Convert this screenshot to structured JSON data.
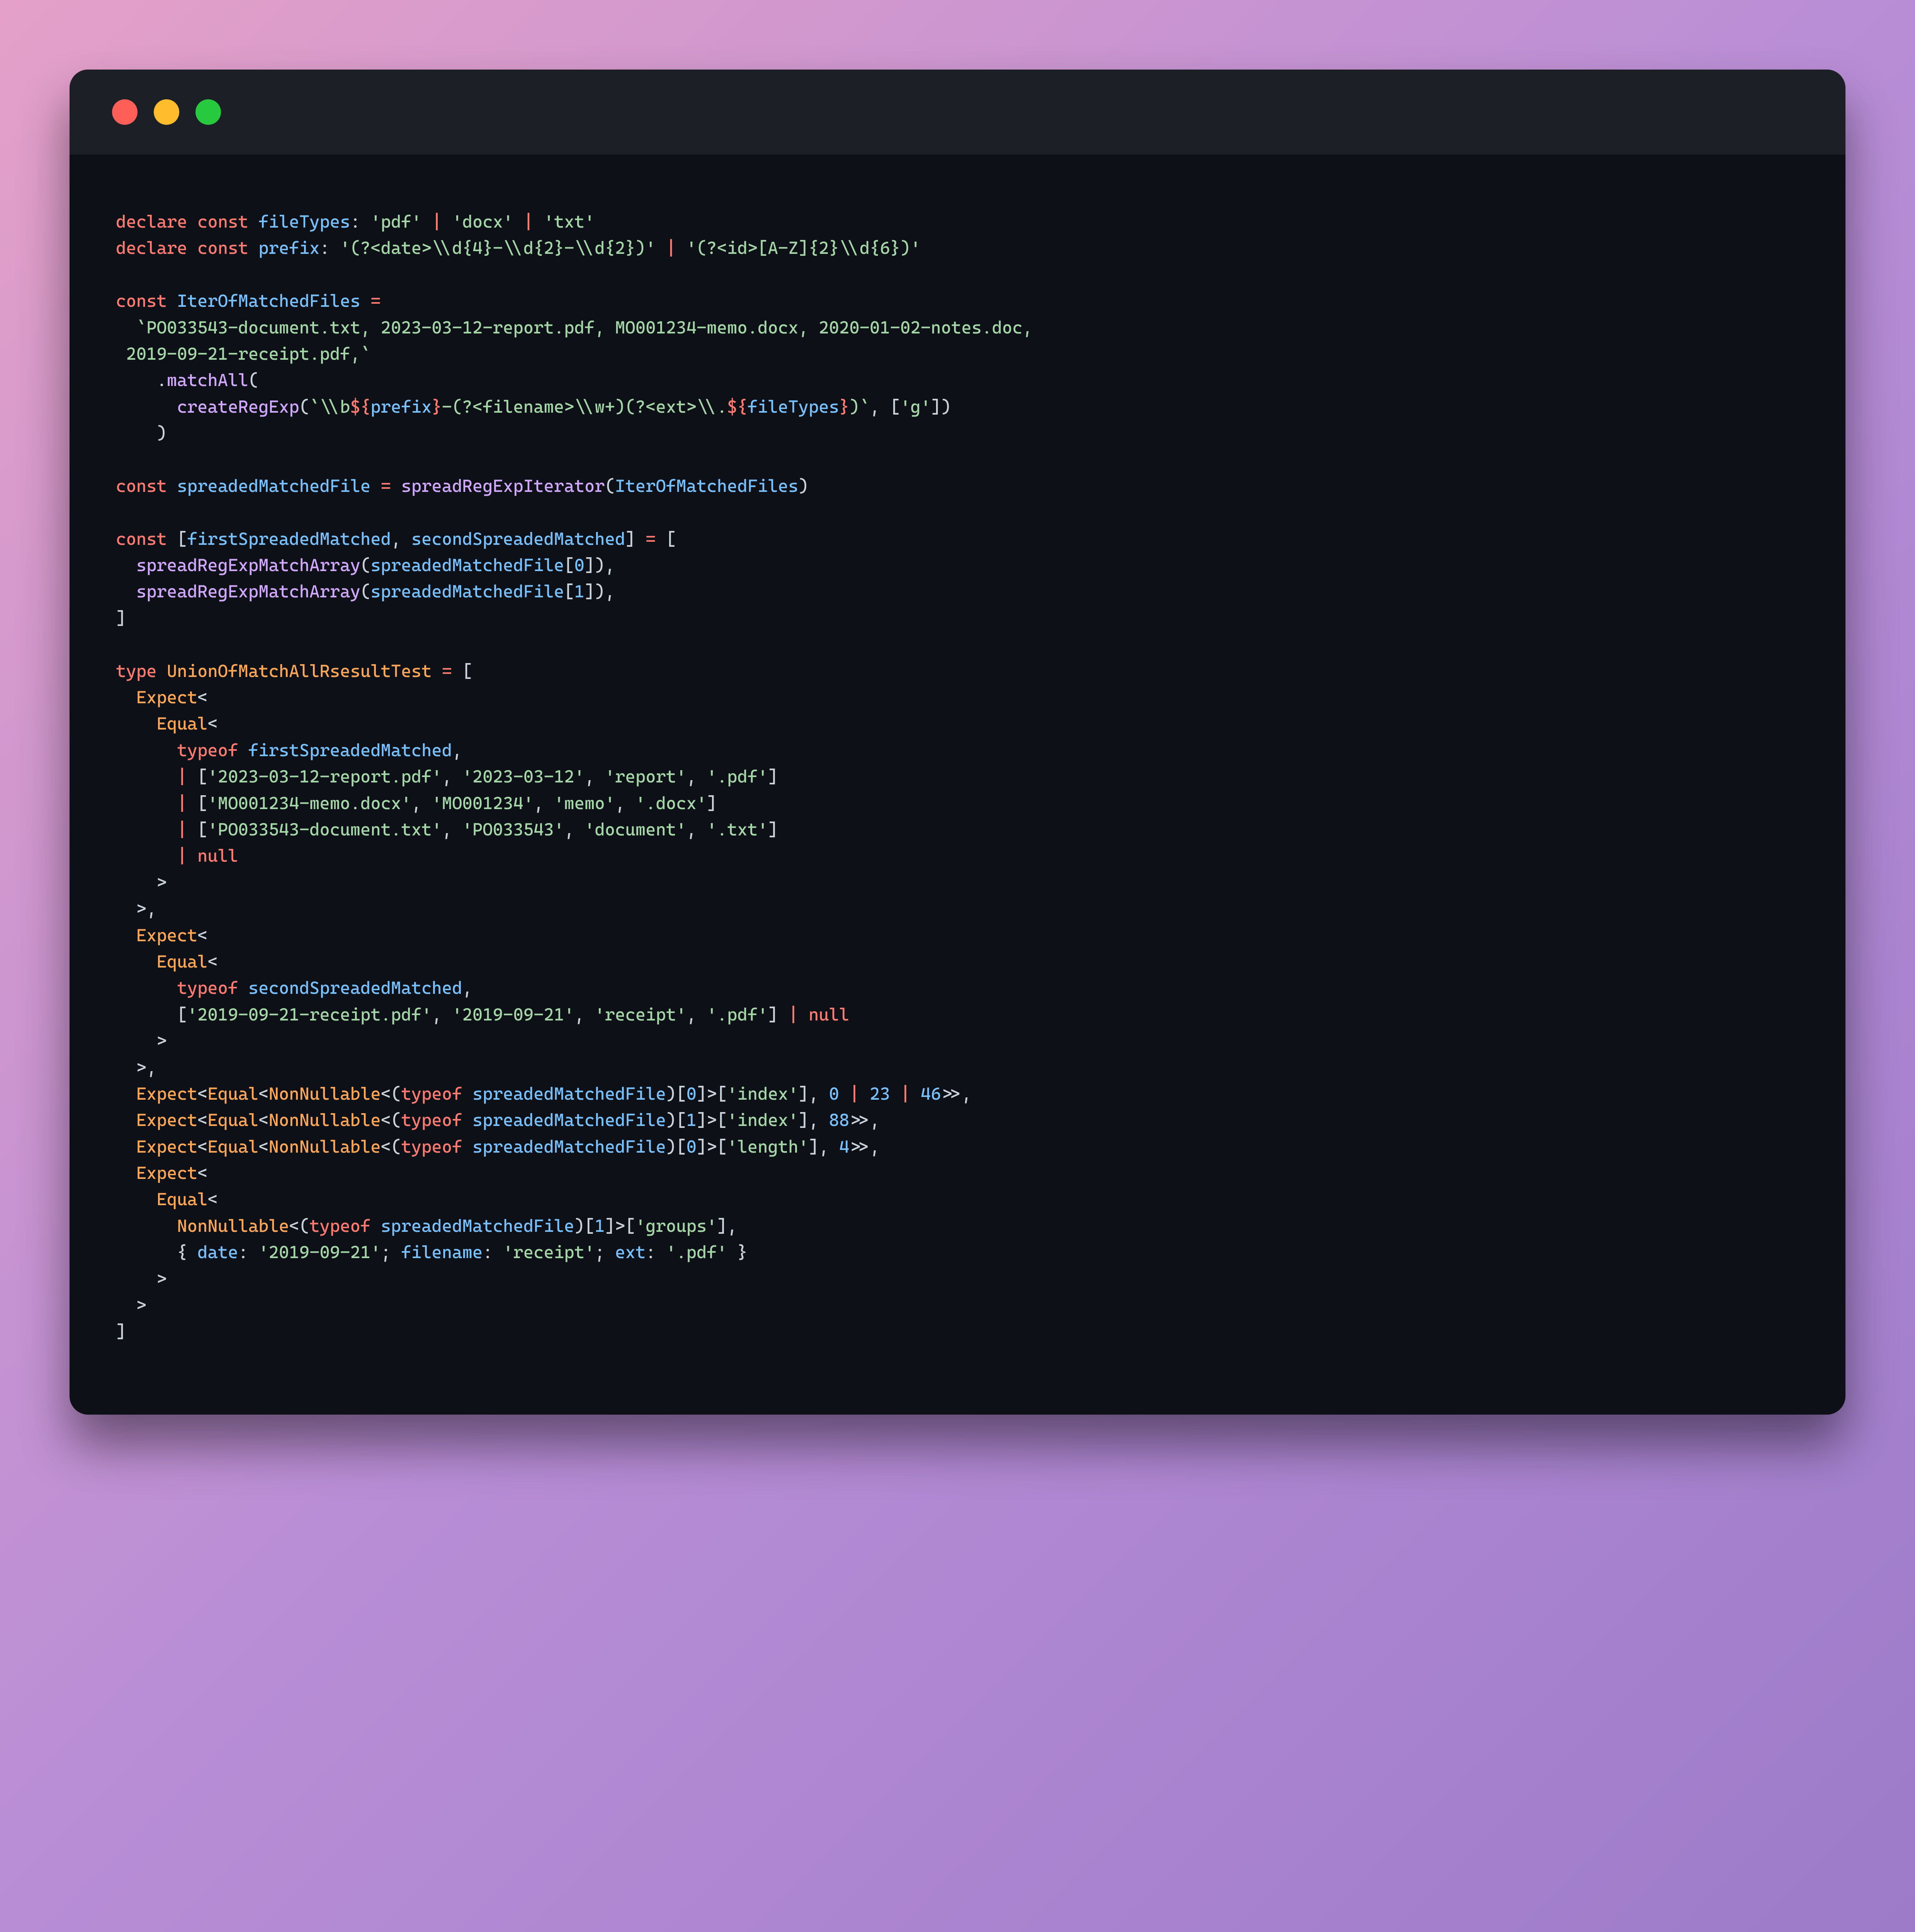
{
  "code": {
    "l01": {
      "a": "declare",
      "b": "const",
      "c": "fileTypes",
      "d": ":",
      "e": "'pdf'",
      "f": "|",
      "g": "'docx'",
      "h": "|",
      "i": "'txt'"
    },
    "l02": {
      "a": "declare",
      "b": "const",
      "c": "prefix",
      "d": ":",
      "e": "'(?<date>\\\\d{4}-\\\\d{2}-\\\\d{2})'",
      "f": "|",
      "g": "'(?<id>[A-Z]{2}\\\\d{6})'"
    },
    "l03": {
      "a": "const",
      "b": "IterOfMatchedFiles",
      "c": "="
    },
    "l04": {
      "a": "`PO033543-document.txt, 2023-03-12-report.pdf, MO001234-memo.docx, 2020-01-02-notes.doc,"
    },
    "l05": {
      "a": " 2019-09-21-receipt.pdf,`"
    },
    "l06": {
      "a": ".",
      "b": "matchAll",
      "c": "("
    },
    "l07": {
      "a": "createRegExp",
      "b": "(",
      "c": "`\\\\b",
      "d": "${",
      "e": "prefix",
      "f": "}",
      "g": "-(?<filename>\\\\w+)(?<ext>\\\\.",
      "h": "${",
      "i": "fileTypes",
      "j": "}",
      "k": ")`",
      "l": ", [",
      "m": "'g'",
      "n": "])"
    },
    "l08": {
      "a": ")"
    },
    "l09": {
      "a": "const",
      "b": "spreadedMatchedFile",
      "c": "=",
      "d": "spreadRegExpIterator",
      "e": "(",
      "f": "IterOfMatchedFiles",
      "g": ")"
    },
    "l10": {
      "a": "const",
      "b": "[",
      "c": "firstSpreadedMatched",
      "d": ",",
      "e": "secondSpreadedMatched",
      "f": "]",
      "g": "=",
      "h": "["
    },
    "l11": {
      "a": "spreadRegExpMatchArray",
      "b": "(",
      "c": "spreadedMatchedFile",
      "d": "[",
      "e": "0",
      "f": "]),"
    },
    "l12": {
      "a": "spreadRegExpMatchArray",
      "b": "(",
      "c": "spreadedMatchedFile",
      "d": "[",
      "e": "1",
      "f": "]),"
    },
    "l13": {
      "a": "]"
    },
    "l14": {
      "a": "type",
      "b": "UnionOfMatchAllRsesultTest",
      "c": "=",
      "d": "["
    },
    "l15": {
      "a": "Expect",
      "b": "<"
    },
    "l16": {
      "a": "Equal",
      "b": "<"
    },
    "l17": {
      "a": "typeof",
      "b": "firstSpreadedMatched",
      "c": ","
    },
    "l18": {
      "a": "|",
      "b": "[",
      "c": "'2023-03-12-report.pdf'",
      "d": ",",
      "e": "'2023-03-12'",
      "f": ",",
      "g": "'report'",
      "h": ",",
      "i": "'.pdf'",
      "j": "]"
    },
    "l19": {
      "a": "|",
      "b": "[",
      "c": "'MO001234-memo.docx'",
      "d": ",",
      "e": "'MO001234'",
      "f": ",",
      "g": "'memo'",
      "h": ",",
      "i": "'.docx'",
      "j": "]"
    },
    "l20": {
      "a": "|",
      "b": "[",
      "c": "'PO033543-document.txt'",
      "d": ",",
      "e": "'PO033543'",
      "f": ",",
      "g": "'document'",
      "h": ",",
      "i": "'.txt'",
      "j": "]"
    },
    "l21": {
      "a": "|",
      "b": "null"
    },
    "l22": {
      "a": ">"
    },
    "l23": {
      "a": ">,"
    },
    "l24": {
      "a": "Expect",
      "b": "<"
    },
    "l25": {
      "a": "Equal",
      "b": "<"
    },
    "l26": {
      "a": "typeof",
      "b": "secondSpreadedMatched",
      "c": ","
    },
    "l27": {
      "a": "[",
      "b": "'2019-09-21-receipt.pdf'",
      "c": ",",
      "d": "'2019-09-21'",
      "e": ",",
      "f": "'receipt'",
      "g": ",",
      "h": "'.pdf'",
      "i": "]",
      "j": "|",
      "k": "null"
    },
    "l28": {
      "a": ">"
    },
    "l29": {
      "a": ">,"
    },
    "l30": {
      "a": "Expect",
      "b": "<",
      "c": "Equal",
      "d": "<",
      "e": "NonNullable",
      "f": "<(",
      "g": "typeof",
      "h": "spreadedMatchedFile",
      "i": ")[",
      "j": "0",
      "k": "]>[",
      "l": "'index'",
      "m": "],",
      "n": "0",
      "o": "|",
      "p": "23",
      "q": "|",
      "r": "46",
      "s": ">>,"
    },
    "l31": {
      "a": "Expect",
      "b": "<",
      "c": "Equal",
      "d": "<",
      "e": "NonNullable",
      "f": "<(",
      "g": "typeof",
      "h": "spreadedMatchedFile",
      "i": ")[",
      "j": "1",
      "k": "]>[",
      "l": "'index'",
      "m": "],",
      "n": "88",
      "o": ">>,"
    },
    "l32": {
      "a": "Expect",
      "b": "<",
      "c": "Equal",
      "d": "<",
      "e": "NonNullable",
      "f": "<(",
      "g": "typeof",
      "h": "spreadedMatchedFile",
      "i": ")[",
      "j": "0",
      "k": "]>[",
      "l": "'length'",
      "m": "],",
      "n": "4",
      "o": ">>,"
    },
    "l33": {
      "a": "Expect",
      "b": "<"
    },
    "l34": {
      "a": "Equal",
      "b": "<"
    },
    "l35": {
      "a": "NonNullable",
      "b": "<(",
      "c": "typeof",
      "d": "spreadedMatchedFile",
      "e": ")[",
      "f": "1",
      "g": "]>[",
      "h": "'groups'",
      "i": "],"
    },
    "l36": {
      "a": "{",
      "b": "date",
      "c": ":",
      "d": "'2019-09-21'",
      "e": ";",
      "f": "filename",
      "g": ":",
      "h": "'receipt'",
      "i": ";",
      "j": "ext",
      "k": ":",
      "l": "'.pdf'",
      "m": "}"
    },
    "l37": {
      "a": ">"
    },
    "l38": {
      "a": ">"
    },
    "l39": {
      "a": "]"
    }
  }
}
